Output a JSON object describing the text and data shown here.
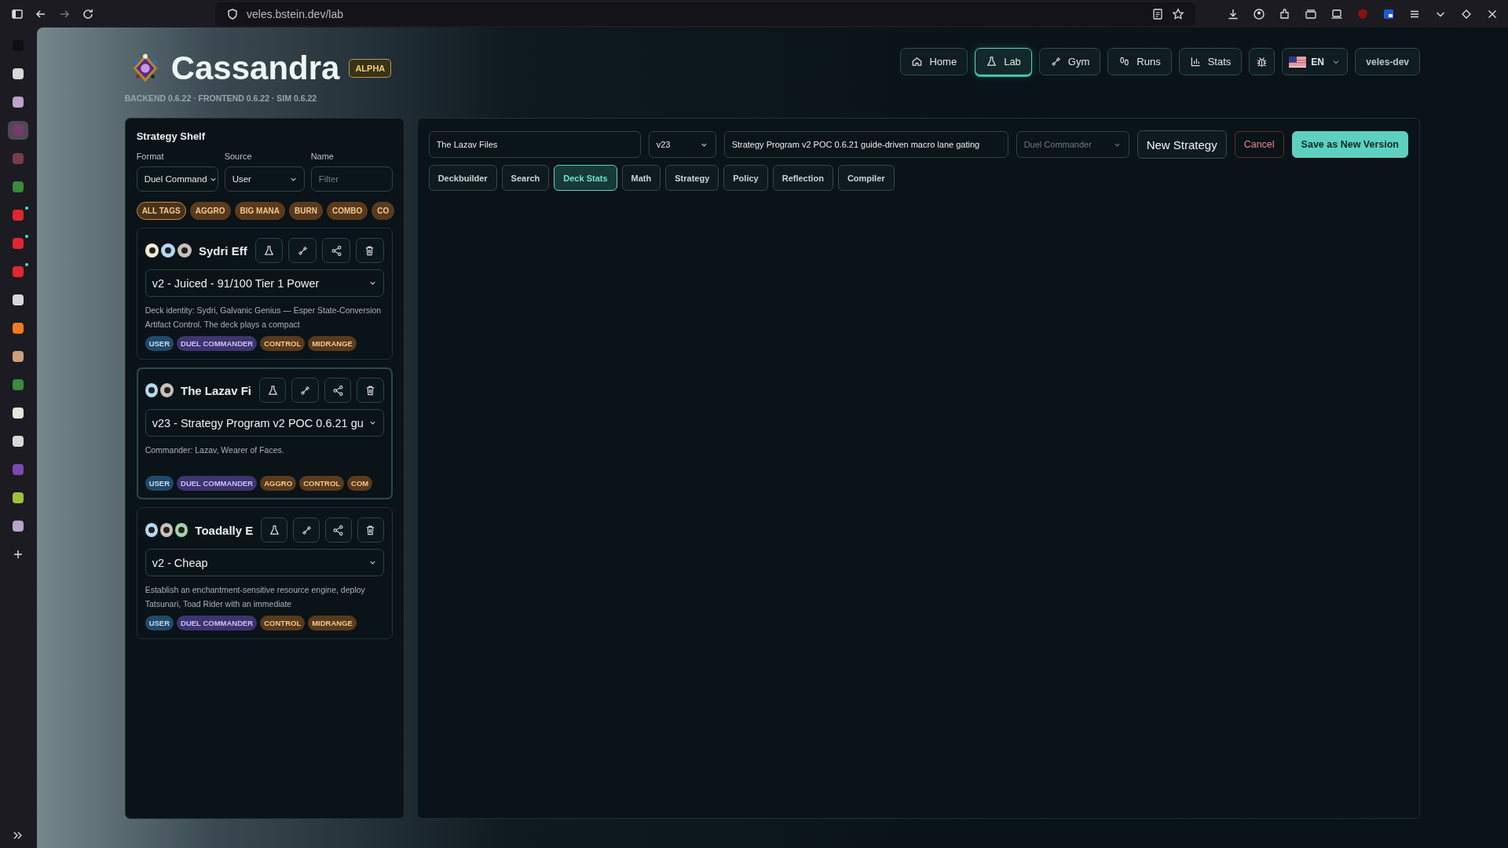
{
  "browser": {
    "url": "veles.bstein.dev/lab",
    "tabs": [
      {
        "color": "#101010",
        "selected": false,
        "notification": false
      },
      {
        "color": "#d8d8d8",
        "selected": false,
        "notification": false
      },
      {
        "color": "#b9a3c9",
        "selected": false,
        "notification": false
      },
      {
        "color": "#7a3a6a",
        "selected": true,
        "notification": false
      },
      {
        "color": "#7a3a4a",
        "selected": false,
        "notification": false
      },
      {
        "color": "#3b8a3e",
        "selected": false,
        "notification": false
      },
      {
        "color": "#e0262e",
        "selected": false,
        "notification": true
      },
      {
        "color": "#e0262e",
        "selected": false,
        "notification": true
      },
      {
        "color": "#e0262e",
        "selected": false,
        "notification": true
      },
      {
        "color": "#d8d8d8",
        "selected": false,
        "notification": false
      },
      {
        "color": "#f07a22",
        "selected": false,
        "notification": false
      },
      {
        "color": "#c9a07a",
        "selected": false,
        "notification": false
      },
      {
        "color": "#3b8a3e",
        "selected": false,
        "notification": false
      },
      {
        "color": "#e8e4da",
        "selected": false,
        "notification": false
      },
      {
        "color": "#d8d8d8",
        "selected": false,
        "notification": false
      },
      {
        "color": "#7a4ab0",
        "selected": false,
        "notification": false
      },
      {
        "color": "#a0c040",
        "selected": false,
        "notification": false
      },
      {
        "color": "#b9a3c9",
        "selected": false,
        "notification": false
      }
    ]
  },
  "header": {
    "title": "Cassandra",
    "badge": "ALPHA",
    "versions": "BACKEND 0.6.22 · FRONTEND 0.6.22 · SIM 0.6.22",
    "nav": [
      {
        "kind": "home",
        "label": "Home",
        "selected": false
      },
      {
        "kind": "lab",
        "label": "Lab",
        "selected": true
      },
      {
        "kind": "gym",
        "label": "Gym",
        "selected": false
      },
      {
        "kind": "runs",
        "label": "Runs",
        "selected": false
      },
      {
        "kind": "stats",
        "label": "Stats",
        "selected": false
      }
    ],
    "language": "EN",
    "user": "veles-dev"
  },
  "shelf": {
    "title": "Strategy Shelf",
    "filters": [
      {
        "kind": "select",
        "label": "Format",
        "value": "Duel Command"
      },
      {
        "kind": "select",
        "label": "Source",
        "value": "User"
      },
      {
        "kind": "input",
        "label": "Name",
        "placeholder": "Filter"
      }
    ],
    "tags": [
      {
        "label": "ALL TAGS",
        "selected": true
      },
      {
        "label": "AGGRO",
        "selected": false
      },
      {
        "label": "BIG MANA",
        "selected": false
      },
      {
        "label": "BURN",
        "selected": false
      },
      {
        "label": "COMBO",
        "selected": false
      },
      {
        "label": "CO",
        "selected": false
      }
    ],
    "cards": [
      {
        "name": "Sydri Eff",
        "selected": false,
        "pips": [
          {
            "color": "#f3ecd0"
          },
          {
            "color": "#b3d8f2"
          },
          {
            "color": "#c9c0ba"
          }
        ],
        "version": "v2 - Juiced - 91/100 Tier 1 Power",
        "description": "Deck identity: Sydri, Galvanic Genius — Esper State-Conversion Artifact Control. The deck plays a compact",
        "tags": [
          {
            "kind": "source",
            "label": "USER"
          },
          {
            "kind": "format",
            "label": "DUEL COMMANDER"
          },
          {
            "kind": "archetype",
            "label": "CONTROL"
          },
          {
            "kind": "archetype",
            "label": "MIDRANGE"
          }
        ]
      },
      {
        "name": "The Lazav Fi",
        "selected": true,
        "pips": [
          {
            "color": "#b3d8f2"
          },
          {
            "color": "#c9c0ba"
          }
        ],
        "version": "v23 - Strategy Program v2 POC 0.6.21 gu",
        "description": "Commander: Lazav, Wearer of Faces.",
        "tags": [
          {
            "kind": "source",
            "label": "USER"
          },
          {
            "kind": "format",
            "label": "DUEL COMMANDER"
          },
          {
            "kind": "archetype",
            "label": "AGGRO"
          },
          {
            "kind": "archetype",
            "label": "CONTROL"
          },
          {
            "kind": "archetype",
            "label": "COM"
          }
        ]
      },
      {
        "name": "Toadally E",
        "selected": false,
        "pips": [
          {
            "color": "#b3d8f2"
          },
          {
            "color": "#c9c0ba"
          },
          {
            "color": "#a3d3a8"
          }
        ],
        "version": "v2 - Cheap",
        "description": "Establish an enchantment-sensitive resource engine, deploy Tatsunari, Toad Rider with an immediate",
        "tags": [
          {
            "kind": "source",
            "label": "USER"
          },
          {
            "kind": "format",
            "label": "DUEL COMMANDER"
          },
          {
            "kind": "archetype",
            "label": "CONTROL"
          },
          {
            "kind": "archetype",
            "label": "MIDRANGE"
          }
        ]
      }
    ]
  },
  "editor": {
    "name": "The Lazav Files",
    "version": "v23",
    "description": "Strategy Program v2 POC 0.6.21 guide-driven macro lane gating",
    "format": {
      "value": "Duel Commander",
      "disabled": true
    },
    "buttons": [
      {
        "kind": "secondary",
        "label": "New Strategy"
      },
      {
        "kind": "danger",
        "label": "Cancel"
      },
      {
        "kind": "primary",
        "label": "Save as New Version"
      }
    ],
    "tabs": [
      {
        "label": "Deckbuilder",
        "selected": false
      },
      {
        "label": "Search",
        "selected": false
      },
      {
        "label": "Deck Stats",
        "selected": true
      },
      {
        "label": "Math",
        "selected": false
      },
      {
        "label": "Strategy",
        "selected": false
      },
      {
        "label": "Policy",
        "selected": false
      },
      {
        "label": "Reflection",
        "selected": false
      },
      {
        "label": "Compiler",
        "selected": false
      }
    ]
  }
}
